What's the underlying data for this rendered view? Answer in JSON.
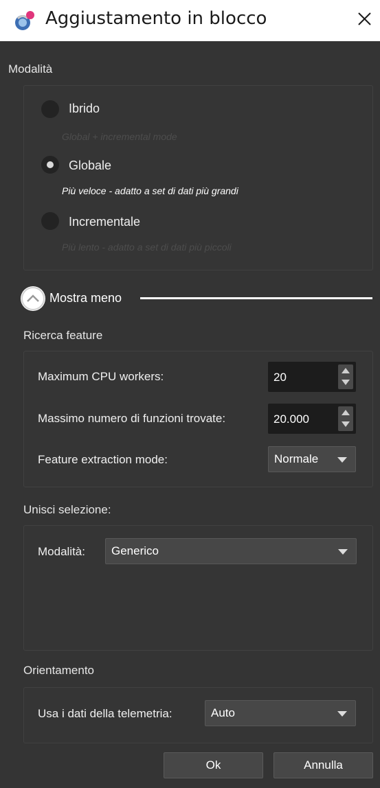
{
  "window": {
    "title": "Aggiustamento in blocco",
    "app_icon": "app-icon",
    "close_icon": "close-icon"
  },
  "modalita": {
    "label": "Modalità",
    "options": [
      {
        "label": "Ibrido",
        "desc": "Global + incremental mode",
        "checked": false
      },
      {
        "label": "Globale",
        "desc": "Più veloce - adatto a set di dati più grandi",
        "checked": true
      },
      {
        "label": "Incrementale",
        "desc": "Più lento - adatto a set di dati più piccoli",
        "checked": false
      }
    ]
  },
  "toggle": {
    "label": "Mostra meno",
    "icon": "chevron-up-icon"
  },
  "ricerca": {
    "label": "Ricerca feature",
    "cpu_label": "Maximum CPU workers:",
    "cpu_value": "20",
    "max_label": "Massimo numero di funzioni trovate:",
    "max_value": "20.000",
    "extraction_label": "Feature extraction mode:",
    "extraction_value": "Normale"
  },
  "unisci": {
    "label": "Unisci selezione:",
    "mode_label": "Modalità:",
    "mode_value": "Generico"
  },
  "orientamento": {
    "label": "Orientamento",
    "telemetry_label": "Usa i dati della telemetria:",
    "telemetry_value": "Auto"
  },
  "buttons": {
    "ok": "Ok",
    "cancel": "Annulla"
  },
  "colors": {
    "panel_bg": "#343434",
    "field_bg": "#1c1c1c",
    "combo_bg": "#474747",
    "accent_text": "#ffffff"
  }
}
